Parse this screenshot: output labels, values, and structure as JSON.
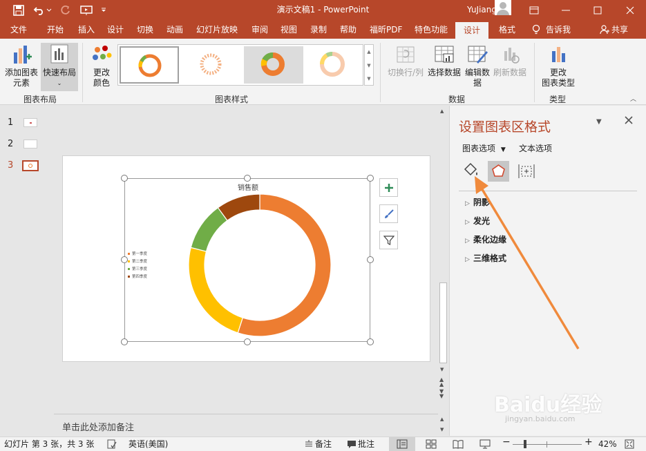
{
  "window": {
    "title": "演示文稿1  -  PowerPoint",
    "user": "YuJiang Li"
  },
  "tabs": [
    "文件",
    "开始",
    "插入",
    "设计",
    "切换",
    "动画",
    "幻灯片放映",
    "审阅",
    "视图",
    "录制",
    "帮助",
    "福昕PDF",
    "特色功能",
    "设计",
    "格式"
  ],
  "tell_me": "告诉我",
  "share": "共享",
  "ribbon": {
    "add_element": "添加图表\n元素",
    "quick_layout": "快速布局",
    "group_layout": "图表布局",
    "change_color": "更改\n颜色",
    "group_styles": "图表样式",
    "switch_rowcol": "切换行/列",
    "select_data": "选择数据",
    "edit_data": "编辑数\n据",
    "refresh_data": "刷新数据",
    "group_data": "数据",
    "change_type": "更改\n图表类型",
    "group_type": "类型"
  },
  "slides": {
    "numbers": [
      "1",
      "2",
      "3"
    ],
    "active": "3"
  },
  "chart": {
    "title": "销售额",
    "legend": [
      "第一季度",
      "第二季度",
      "第三季度",
      "第四季度"
    ]
  },
  "chart_data": {
    "type": "pie",
    "title": "销售额",
    "categories": [
      "第一季度",
      "第二季度",
      "第三季度",
      "第四季度"
    ],
    "values": [
      0.55,
      0.24,
      0.11,
      0.1
    ],
    "colors": [
      "#ed7d31",
      "#ffc000",
      "#70ad47",
      "#9e480e"
    ],
    "legend": "left",
    "style": "doughnut"
  },
  "notes": {
    "placeholder": "单击此处添加备注"
  },
  "format_pane": {
    "title": "设置图表区格式",
    "chart_options": "图表选项",
    "text_options": "文本选项",
    "items": [
      "阴影",
      "发光",
      "柔化边缘",
      "三维格式"
    ]
  },
  "status": {
    "slide": "幻灯片 第 3 张，共 3 张",
    "lang": "英语(美国)",
    "notes": "备注",
    "comments": "批注",
    "zoom": "42%"
  },
  "watermark": {
    "text": "Baidu经验",
    "url": "jingyan.baidu.com"
  }
}
